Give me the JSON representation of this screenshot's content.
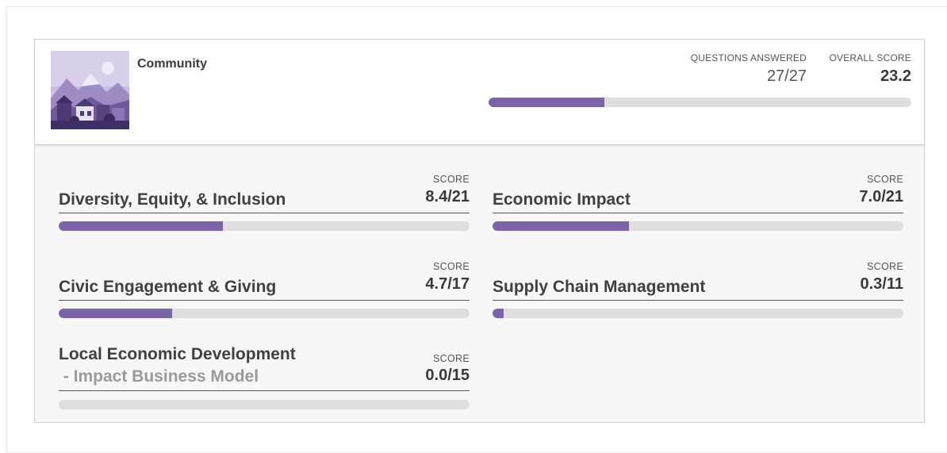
{
  "section": {
    "title": "Community",
    "questions_answered_label": "QUESTIONS ANSWERED",
    "questions_answered_value": "27/27",
    "overall_score_label": "OVERALL SCORE",
    "overall_score_value": "23.2",
    "overall_progress": 0.273
  },
  "colors": {
    "accent": "#7b63a8",
    "track": "#dedede",
    "panel": "#f7f7f7"
  },
  "categories": [
    {
      "name": "Diversity, Equity, & Inclusion",
      "score_label": "SCORE",
      "score": "8.4/21",
      "progress": 0.4
    },
    {
      "name": "Economic Impact",
      "score_label": "SCORE",
      "score": "7.0/21",
      "progress": 0.333
    },
    {
      "name": "Civic Engagement & Giving",
      "score_label": "SCORE",
      "score": "4.7/17",
      "progress": 0.276
    },
    {
      "name": "Supply Chain Management",
      "score_label": "SCORE",
      "score": "0.3/11",
      "progress": 0.027
    },
    {
      "name": "Local Economic Development",
      "subtitle": " - Impact Business Model",
      "score_label": "SCORE",
      "score": "0.0/15",
      "progress": 0.0
    }
  ],
  "icons": {
    "thumbnail": "community-illustration"
  }
}
